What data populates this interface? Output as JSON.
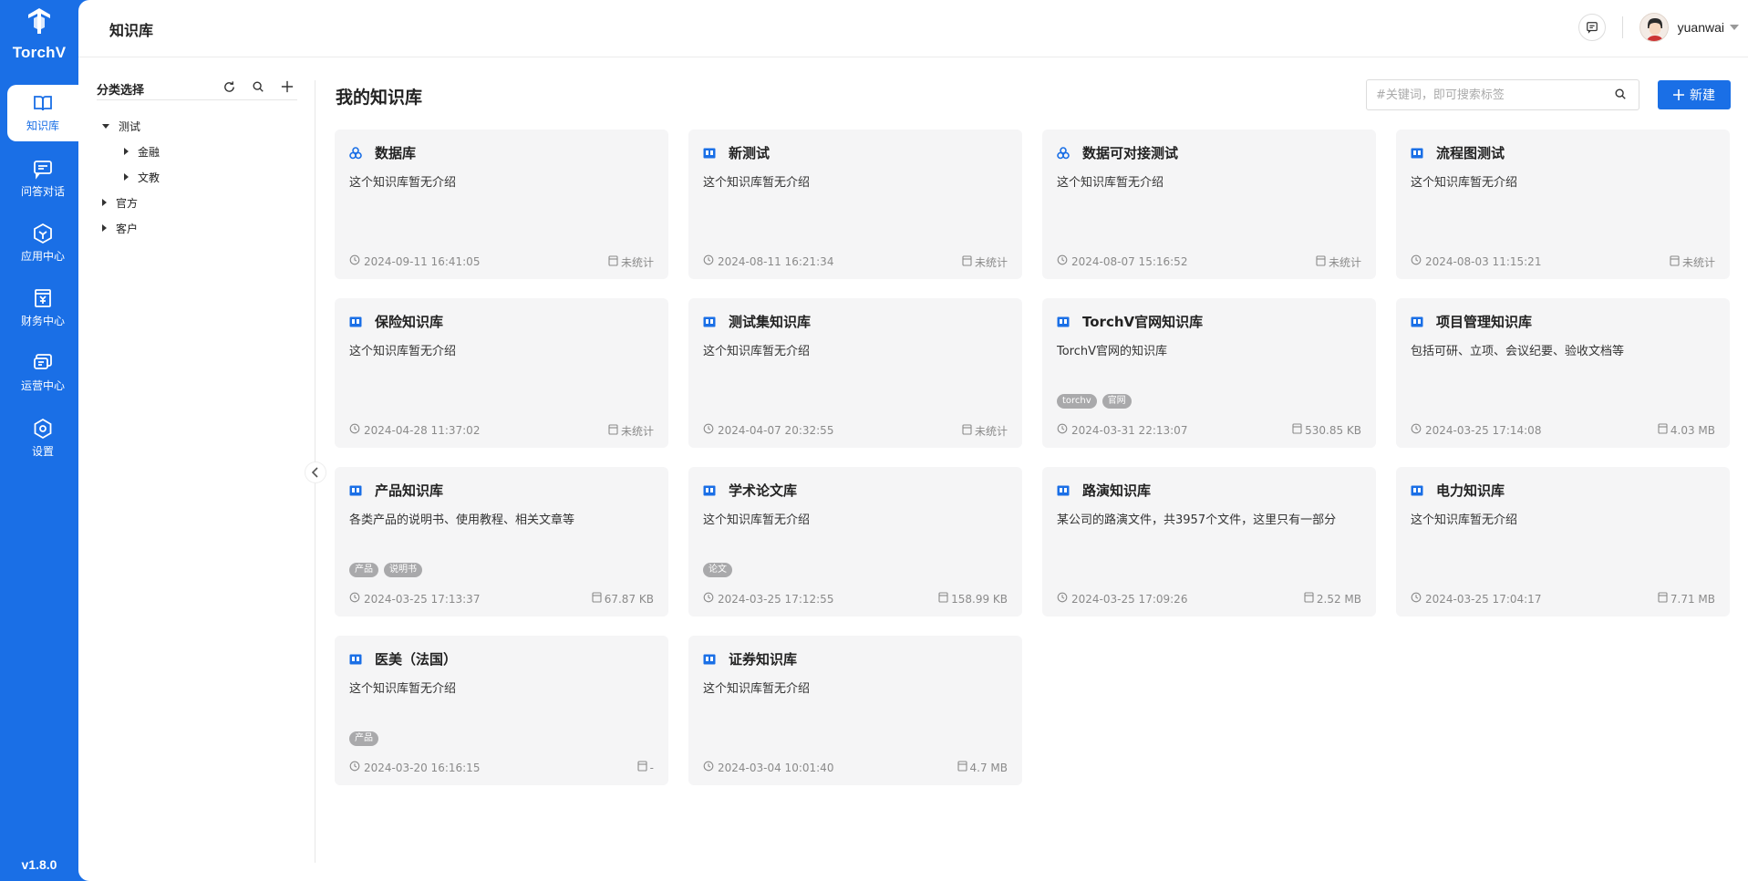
{
  "app": {
    "name": "TorchV",
    "version": "v1.8.0"
  },
  "nav": [
    {
      "label": "知识库",
      "icon": "book-icon",
      "active": true
    },
    {
      "label": "问答对话",
      "icon": "chat-icon"
    },
    {
      "label": "应用中心",
      "icon": "app-hex-icon"
    },
    {
      "label": "财务中心",
      "icon": "finance-icon"
    },
    {
      "label": "运营中心",
      "icon": "operations-icon"
    },
    {
      "label": "设置",
      "icon": "settings-icon"
    }
  ],
  "header": {
    "title": "知识库",
    "username": "yuanwai"
  },
  "categories": {
    "title": "分类选择",
    "tree": [
      {
        "label": "测试",
        "expanded": true,
        "level": 0
      },
      {
        "label": "金融",
        "expanded": false,
        "level": 1
      },
      {
        "label": "文教",
        "expanded": false,
        "level": 1
      },
      {
        "label": "官方",
        "expanded": false,
        "level": 0
      },
      {
        "label": "客户",
        "expanded": false,
        "level": 0
      }
    ]
  },
  "main": {
    "title": "我的知识库",
    "search_placeholder": "#关键词，即可搜索标签",
    "new_label": "新建"
  },
  "knowledge_bases": [
    {
      "title": "数据库",
      "icon": "database-icon",
      "desc": "这个知识库暂无介绍",
      "tags": [],
      "date": "2024-09-11 16:41:05",
      "size": "未统计"
    },
    {
      "title": "新测试",
      "icon": "book-icon",
      "desc": "这个知识库暂无介绍",
      "tags": [],
      "date": "2024-08-11 16:21:34",
      "size": "未统计"
    },
    {
      "title": "数据可对接测试",
      "icon": "database-icon",
      "desc": "这个知识库暂无介绍",
      "tags": [],
      "date": "2024-08-07 15:16:52",
      "size": "未统计"
    },
    {
      "title": "流程图测试",
      "icon": "book-icon",
      "desc": "这个知识库暂无介绍",
      "tags": [],
      "date": "2024-08-03 11:15:21",
      "size": "未统计"
    },
    {
      "title": "保险知识库",
      "icon": "book-icon",
      "desc": "这个知识库暂无介绍",
      "tags": [],
      "date": "2024-04-28 11:37:02",
      "size": "未统计"
    },
    {
      "title": "测试集知识库",
      "icon": "book-icon",
      "desc": "这个知识库暂无介绍",
      "tags": [],
      "date": "2024-04-07 20:32:55",
      "size": "未统计"
    },
    {
      "title": "TorchV官网知识库",
      "icon": "book-icon",
      "desc": "TorchV官网的知识库",
      "tags": [
        "torchv",
        "官网"
      ],
      "date": "2024-03-31 22:13:07",
      "size": "530.85 KB"
    },
    {
      "title": "项目管理知识库",
      "icon": "book-icon",
      "desc": "包括可研、立项、会议纪要、验收文档等",
      "tags": [],
      "date": "2024-03-25 17:14:08",
      "size": "4.03 MB"
    },
    {
      "title": "产品知识库",
      "icon": "book-icon",
      "desc": "各类产品的说明书、使用教程、相关文章等",
      "tags": [
        "产品",
        "说明书"
      ],
      "date": "2024-03-25 17:13:37",
      "size": "67.87 KB"
    },
    {
      "title": "学术论文库",
      "icon": "book-icon",
      "desc": "这个知识库暂无介绍",
      "tags": [
        "论文"
      ],
      "date": "2024-03-25 17:12:55",
      "size": "158.99 KB"
    },
    {
      "title": "路演知识库",
      "icon": "book-icon",
      "desc": "某公司的路演文件，共3957个文件，这里只有一部分",
      "tags": [],
      "date": "2024-03-25 17:09:26",
      "size": "2.52 MB"
    },
    {
      "title": "电力知识库",
      "icon": "book-icon",
      "desc": "这个知识库暂无介绍",
      "tags": [],
      "date": "2024-03-25 17:04:17",
      "size": "7.71 MB"
    },
    {
      "title": "医美（法国）",
      "icon": "book-icon",
      "desc": "这个知识库暂无介绍",
      "tags": [
        "产品"
      ],
      "date": "2024-03-20 16:16:15",
      "size": "-"
    },
    {
      "title": "证券知识库",
      "icon": "book-icon",
      "desc": "这个知识库暂无介绍",
      "tags": [],
      "date": "2024-03-04 10:01:40",
      "size": "4.7 MB"
    }
  ],
  "colors": {
    "brand": "#1a6fe6",
    "card_bg": "#f5f5f6",
    "tag_bg": "#a9a9ab"
  }
}
